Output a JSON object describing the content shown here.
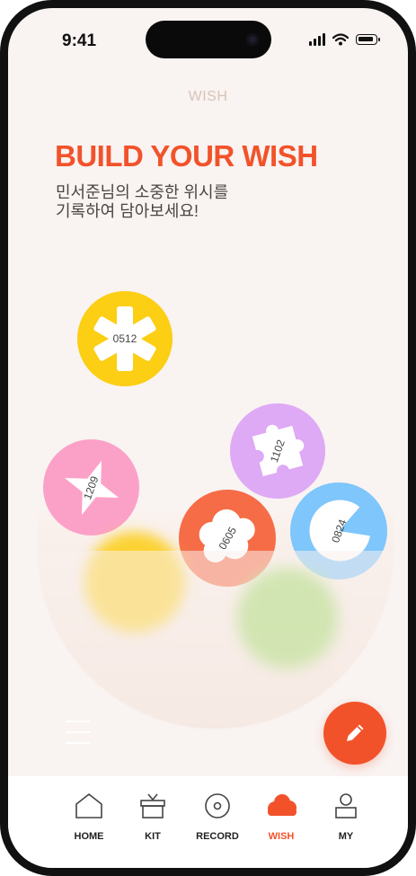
{
  "status": {
    "time": "9:41"
  },
  "header": {
    "title": "WISH"
  },
  "hero": {
    "title": "BUILD YOUR WISH",
    "subtitle_line1": "민서준님의 소중한 위시를",
    "subtitle_line2": "기록하여 담아보세요!"
  },
  "wishes": [
    {
      "label": "0512",
      "color": "#fcce14",
      "shape": "asterisk"
    },
    {
      "label": "1102",
      "color": "#dea9f5",
      "shape": "puzzle"
    },
    {
      "label": "1209",
      "color": "#fba1c7",
      "shape": "star"
    },
    {
      "label": "0605",
      "color": "#f66c47",
      "shape": "cloud"
    },
    {
      "label": "0824",
      "color": "#7ec6fb",
      "shape": "pacman"
    }
  ],
  "tabs": [
    {
      "label": "HOME",
      "icon": "home-icon"
    },
    {
      "label": "KIT",
      "icon": "gift-box-icon"
    },
    {
      "label": "RECORD",
      "icon": "disc-icon"
    },
    {
      "label": "WISH",
      "icon": "cloud-icon",
      "active": true
    },
    {
      "label": "MY",
      "icon": "person-icon"
    }
  ],
  "colors": {
    "accent": "#f2522a",
    "background": "#f9f3f1"
  }
}
